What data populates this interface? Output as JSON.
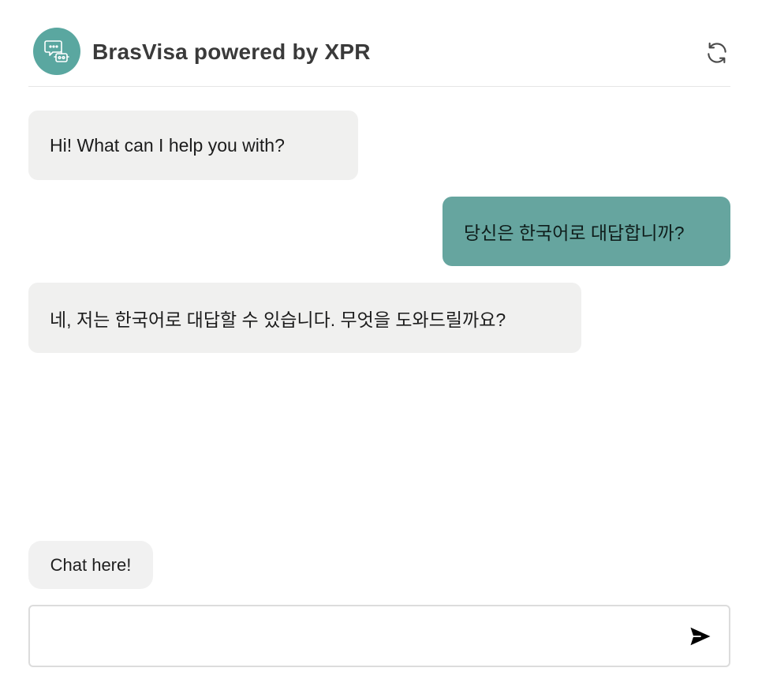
{
  "header": {
    "title": "BrasVisa powered by XPR",
    "avatar_icon": "chat-bot-icon",
    "refresh_icon": "refresh-icon",
    "accent_color": "#5aa7a0"
  },
  "messages": [
    {
      "role": "bot",
      "text": "Hi! What can I help you with?"
    },
    {
      "role": "user",
      "text": "당신은 한국어로 대답합니까?"
    },
    {
      "role": "bot",
      "text": "네, 저는 한국어로 대답할 수 있습니다. 무엇을 도와드릴까요?"
    }
  ],
  "hint": {
    "label": "Chat here!"
  },
  "composer": {
    "value": "",
    "placeholder": "",
    "send_icon": "send-icon"
  }
}
